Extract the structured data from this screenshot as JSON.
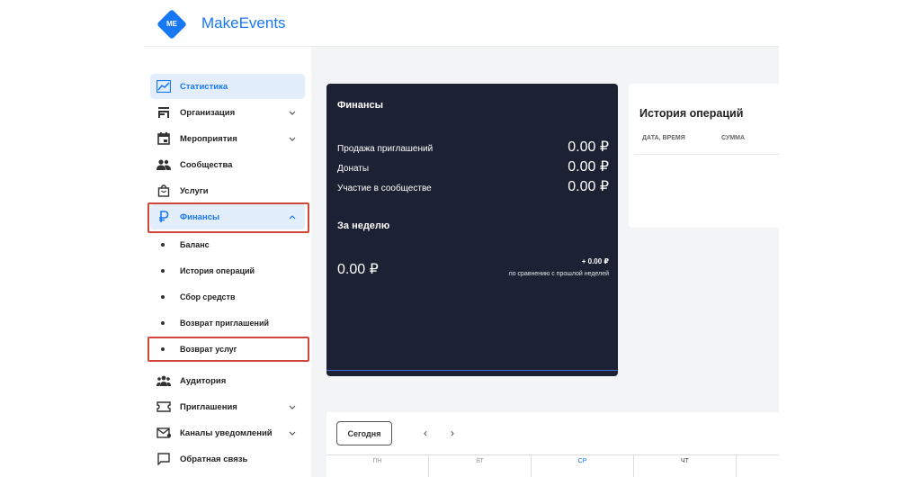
{
  "app": {
    "brand": "MakeEvents",
    "logo_text": "ME"
  },
  "sidebar": {
    "items": [
      {
        "label": "Статистика",
        "icon": "chart-icon",
        "active": true
      },
      {
        "label": "Организация",
        "icon": "store-icon",
        "chevron": "down"
      },
      {
        "label": "Мероприятия",
        "icon": "calendar-icon",
        "chevron": "down"
      },
      {
        "label": "Сообщества",
        "icon": "people-icon"
      },
      {
        "label": "Услуги",
        "icon": "bag-icon"
      },
      {
        "label": "Финансы",
        "icon": "ruble-icon",
        "chevron": "up",
        "open": true
      },
      {
        "label": "Аудитория",
        "icon": "audience-icon"
      },
      {
        "label": "Приглашения",
        "icon": "ticket-icon",
        "chevron": "down"
      },
      {
        "label": "Каналы уведомлений",
        "icon": "mail-icon",
        "chevron": "down"
      },
      {
        "label": "Обратная связь",
        "icon": "feedback-icon"
      }
    ],
    "finance_sub": [
      {
        "label": "Баланс"
      },
      {
        "label": "История операций"
      },
      {
        "label": "Сбор средств"
      },
      {
        "label": "Возврат приглашений"
      },
      {
        "label": "Возврат услуг"
      }
    ]
  },
  "finance": {
    "title": "Финансы",
    "rows": [
      {
        "label": "Продажа приглашений",
        "value": "0.00 ₽"
      },
      {
        "label": "Донаты",
        "value": "0.00 ₽"
      },
      {
        "label": "Участие в сообществе",
        "value": "0.00 ₽"
      }
    ],
    "week_title": "За неделю",
    "week_amount": "0.00 ₽",
    "week_delta": "+ 0.00 ₽",
    "week_compare": "по сравнению с прошлой неделей"
  },
  "history": {
    "title": "История операций",
    "col_datetime": "ДАТА, ВРЕМЯ",
    "col_amount": "СУММА"
  },
  "calendar": {
    "today_label": "Сегодня",
    "prev": "‹",
    "next": "›",
    "days": [
      "ПН",
      "ВТ",
      "СР",
      "ЧТ"
    ]
  },
  "colors": {
    "accent": "#1877f2",
    "dark_card": "#1c2133",
    "highlight": "#d0463a"
  }
}
